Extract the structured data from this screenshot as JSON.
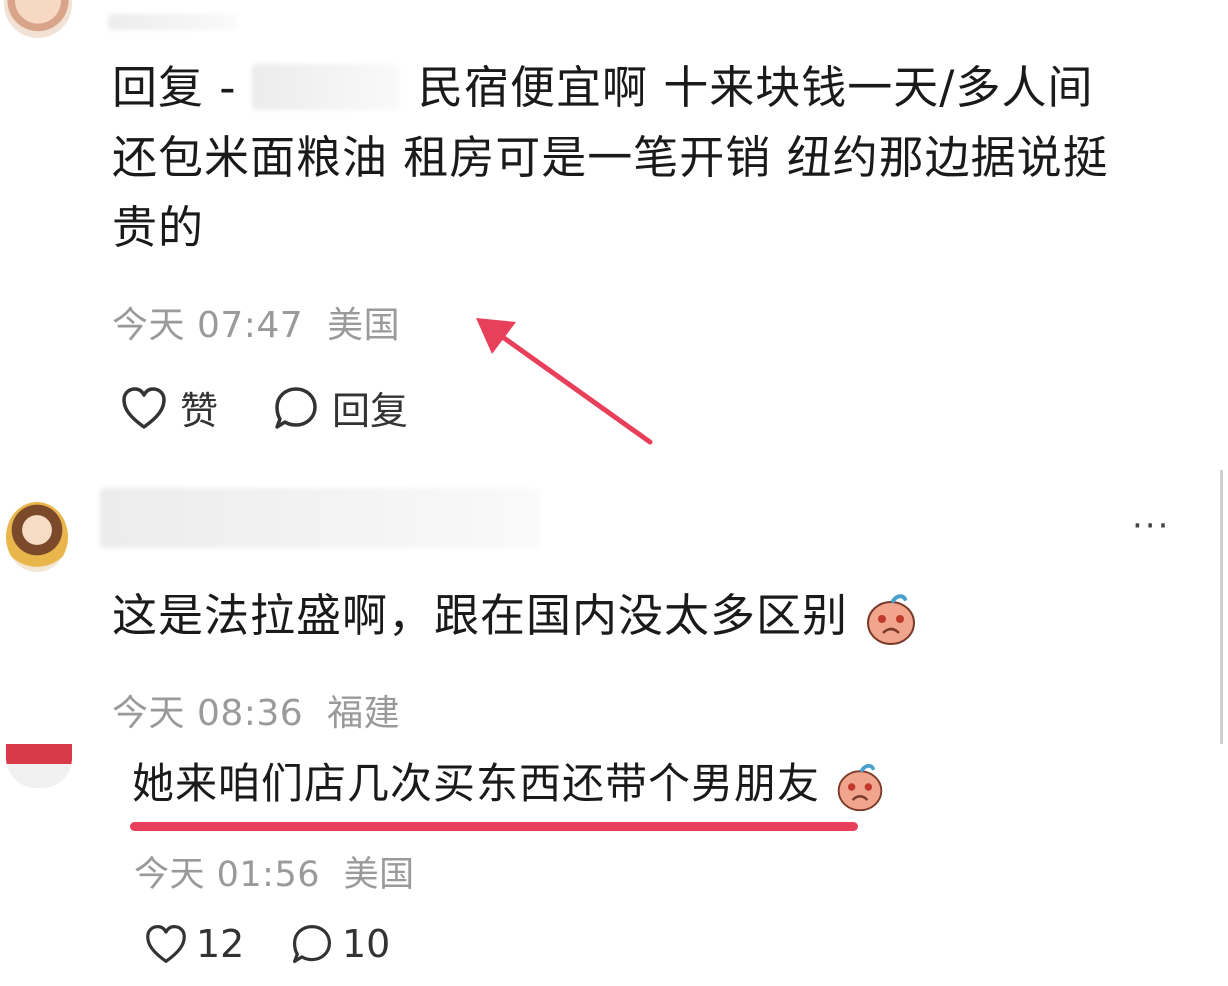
{
  "comment1": {
    "reply_prefix": "回复 -",
    "lines": [
      "民宿便宜啊 十来块钱一天/多人间",
      "还包米面粮油 租房可是一笔开销 纽约那边据说挺",
      "贵的"
    ],
    "time": "今天 07:47",
    "location": "美国",
    "like_label": "赞",
    "reply_label": "回复"
  },
  "comment2": {
    "text": "这是法拉盛啊，跟在国内没太多区别",
    "time": "今天 08:36",
    "location": "福建",
    "more_label": "···"
  },
  "comment3": {
    "text": "她来咱们店几次买东西还带个男朋友",
    "time": "今天 01:56",
    "location": "美国",
    "like_count": "12",
    "reply_count": "10"
  },
  "colors": {
    "arrow": "#e8405a",
    "underline": "#e8405a",
    "meta": "#9a9a9a"
  }
}
